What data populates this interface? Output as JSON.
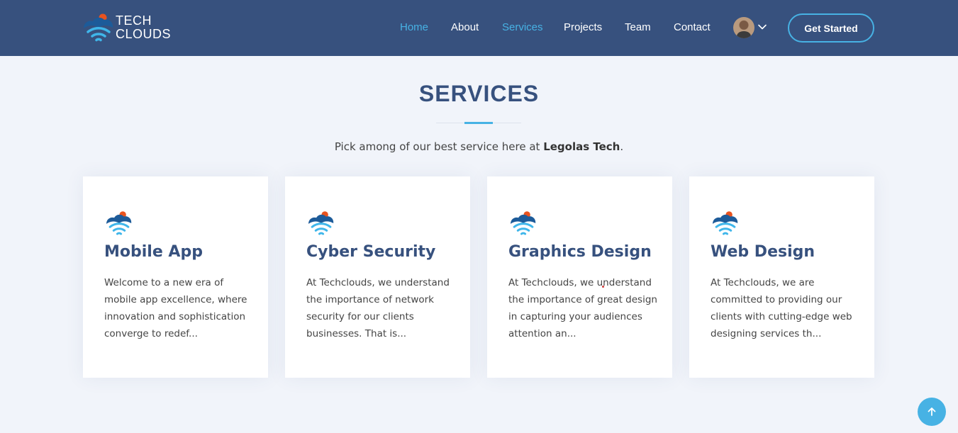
{
  "header": {
    "logo": {
      "line1": "TECH",
      "line2": "CLOUDS",
      "icon": "cloud-wifi-logo-icon"
    },
    "nav": [
      {
        "label": "Home",
        "active": true
      },
      {
        "label": "About",
        "active": false
      },
      {
        "label": "Services",
        "active": true
      },
      {
        "label": "Projects",
        "active": false
      },
      {
        "label": "Team",
        "active": false
      },
      {
        "label": "Contact",
        "active": false
      }
    ],
    "user_menu": {
      "avatar": "user-avatar",
      "icon": "chevron-down-icon"
    },
    "cta_label": "Get Started"
  },
  "section": {
    "title": "SERVICES",
    "subtitle_prefix": "Pick among of our best service here at ",
    "subtitle_brand": "Legolas Tech",
    "subtitle_suffix": "."
  },
  "services": [
    {
      "icon": "cloud-wifi-icon",
      "title": "Mobile App",
      "description": "Welcome to a new era of mobile app excellence, where innovation and sophistication converge to redef..."
    },
    {
      "icon": "cloud-wifi-icon",
      "title": "Cyber Security",
      "description": "At Techclouds, we understand the importance of network security for our clients businesses. That is..."
    },
    {
      "icon": "cloud-wifi-icon",
      "title": "Graphics Design",
      "description": "At Techclouds, we understand the importance of great design in capturing your audiences attention an..."
    },
    {
      "icon": "cloud-wifi-icon",
      "title": "Web Design",
      "description": "At Techclouds, we are committed to providing our clients with cutting-edge web designing services th..."
    }
  ],
  "back_to_top": {
    "icon": "arrow-up-icon"
  },
  "colors": {
    "header_bg": "#37517e",
    "accent": "#47b2e4",
    "page_bg": "#f1f4fa",
    "heading": "#37517e",
    "logo_orange": "#e8531f",
    "logo_dark_blue": "#1d5b99",
    "logo_light_blue": "#3fb6ea"
  }
}
